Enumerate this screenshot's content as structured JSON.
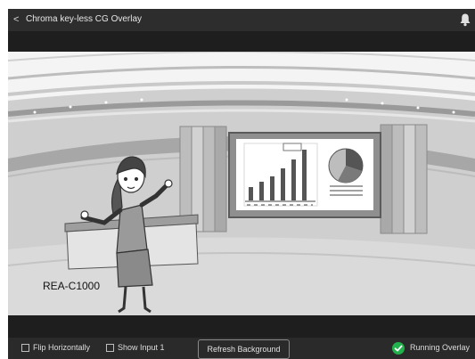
{
  "titlebar": {
    "back_glyph": "<",
    "title": "Chroma key-less CG Overlay",
    "notification_icon": "bell-icon"
  },
  "preview": {
    "overlay_label": "REA-C1000"
  },
  "controls": {
    "flip_label": "Flip Horizontally",
    "flip_checked": false,
    "show_input_label": "Show Input 1",
    "show_input_checked": false,
    "refresh_label": "Refresh Background",
    "status_label": "Running Overlay",
    "status_color": "#22b14c"
  }
}
